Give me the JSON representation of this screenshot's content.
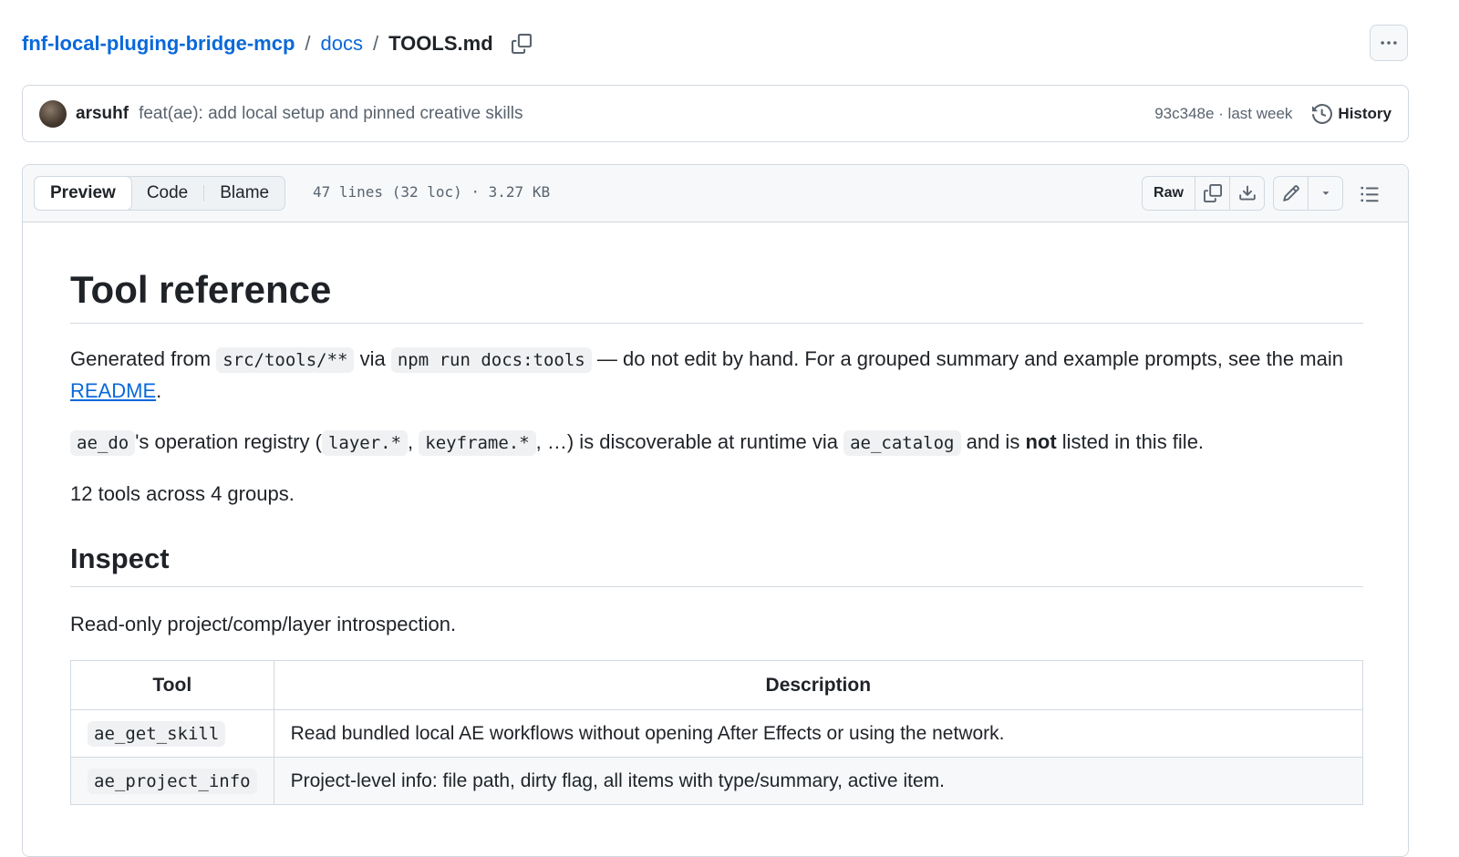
{
  "breadcrumb": {
    "repo": "fnf-local-pluging-bridge-mcp",
    "folder": "docs",
    "separator": "/",
    "file": "TOOLS.md"
  },
  "commit": {
    "author": "arsuhf",
    "message": "feat(ae): add local setup and pinned creative skills",
    "hash_time": "93c348e · last week",
    "history_label": "History"
  },
  "file_toolbar": {
    "tabs": [
      "Preview",
      "Code",
      "Blame"
    ],
    "active_tab": "Preview",
    "meta": "47 lines (32 loc) · 3.27 KB",
    "raw_label": "Raw"
  },
  "markdown": {
    "title": "Tool reference",
    "para1": {
      "t1": "Generated from ",
      "c1": "src/tools/**",
      "t2": " via ",
      "c2": "npm run docs:tools",
      "t3": " — do not edit by hand. For a grouped summary and example prompts, see the main ",
      "link": "README",
      "t4": "."
    },
    "para2": {
      "c1": "ae_do",
      "t1": "'s operation registry (",
      "c2": "layer.*",
      "t2": ", ",
      "c3": "keyframe.*",
      "t3": ", …) is discoverable at runtime via ",
      "c4": "ae_catalog",
      "t4": " and is ",
      "bold": "not",
      "t5": " listed in this file."
    },
    "para3": "12 tools across 4 groups.",
    "section_heading": "Inspect",
    "section_desc": "Read-only project/comp/layer introspection.",
    "table": {
      "headers": [
        "Tool",
        "Description"
      ],
      "rows": [
        {
          "tool": "ae_get_skill",
          "description": "Read bundled local AE workflows without opening After Effects or using the network."
        },
        {
          "tool": "ae_project_info",
          "description": "Project-level info: file path, dirty flag, all items with type/summary, active item."
        }
      ]
    }
  },
  "colors": {
    "link": "#0969da",
    "border": "#d1d9e0",
    "toolbar_bg": "#f6f8fa",
    "code_bg": "#eff1f3"
  }
}
